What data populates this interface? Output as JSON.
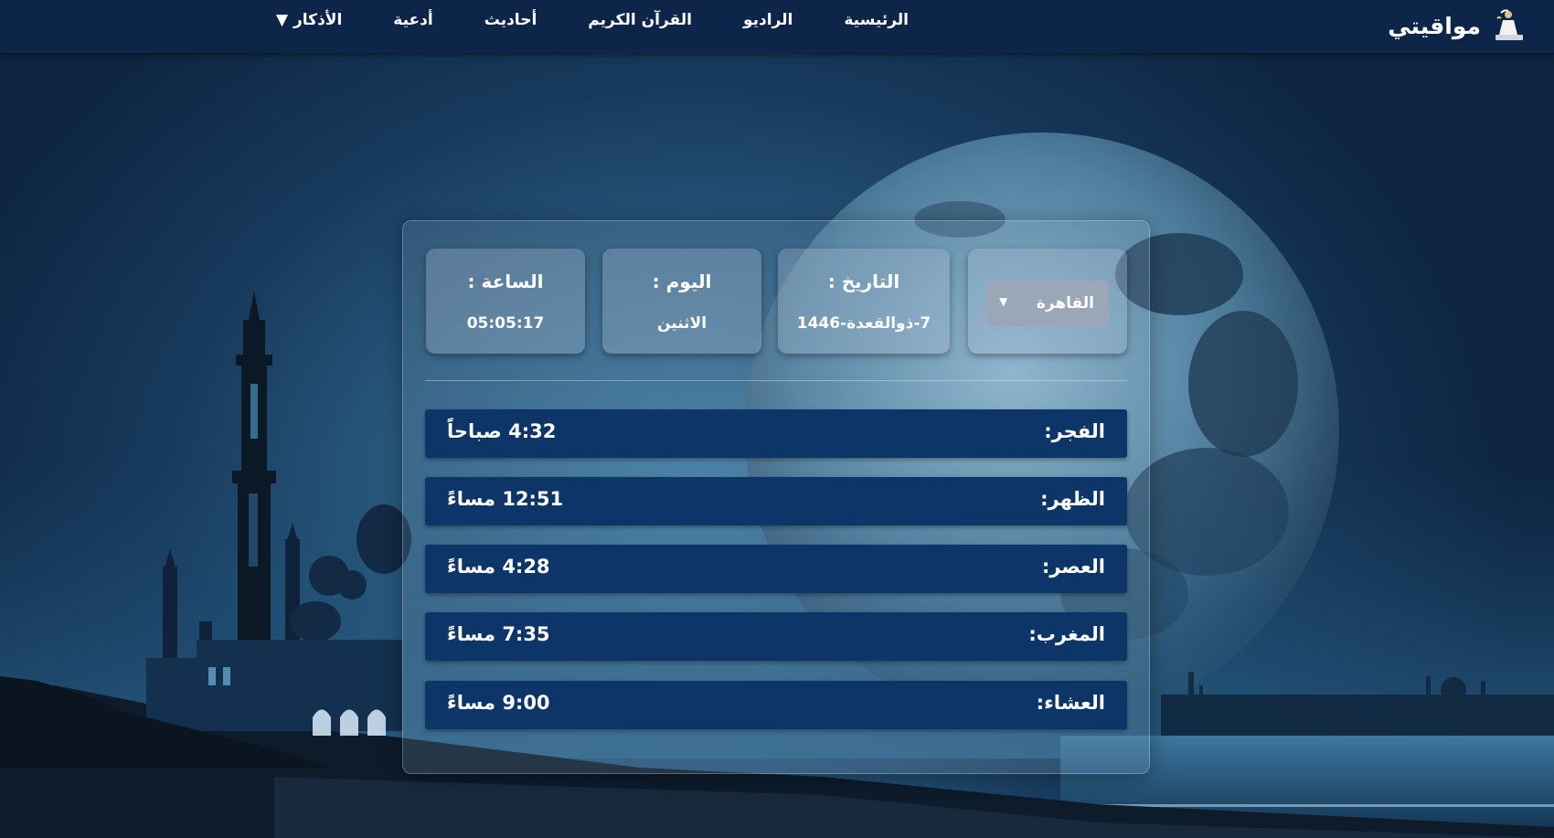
{
  "brand": {
    "name": "مواقيتي",
    "icon": "praying-person-icon"
  },
  "nav": {
    "items": [
      {
        "label": "الرئيسية"
      },
      {
        "label": "الراديو"
      },
      {
        "label": "القرآن الكريم"
      },
      {
        "label": "أحاديث"
      },
      {
        "label": "أدعية"
      },
      {
        "label": "الأذكار ▼"
      }
    ]
  },
  "city": {
    "selected": "القاهرة",
    "icon": "chevron-down-icon"
  },
  "info": {
    "date_label": "التاريخ :",
    "date_value": "7-ذوالقعدة-1446",
    "day_label": "اليوم :",
    "day_value": "الاثنين",
    "time_label": "الساعة :",
    "time_value": "05:05:17"
  },
  "prayers": [
    {
      "name": "الفجر:",
      "time": "4:32 صباحاً"
    },
    {
      "name": "الظهر:",
      "time": "12:51 مساءً"
    },
    {
      "name": "العصر:",
      "time": "4:28 مساءً"
    },
    {
      "name": "المغرب:",
      "time": "7:35 مساءً"
    },
    {
      "name": "العشاء:",
      "time": "9:00 مساءً"
    }
  ],
  "colors": {
    "navbar": "#0c2548",
    "prayer_row": "#0d3567",
    "text": "#ffffff"
  }
}
